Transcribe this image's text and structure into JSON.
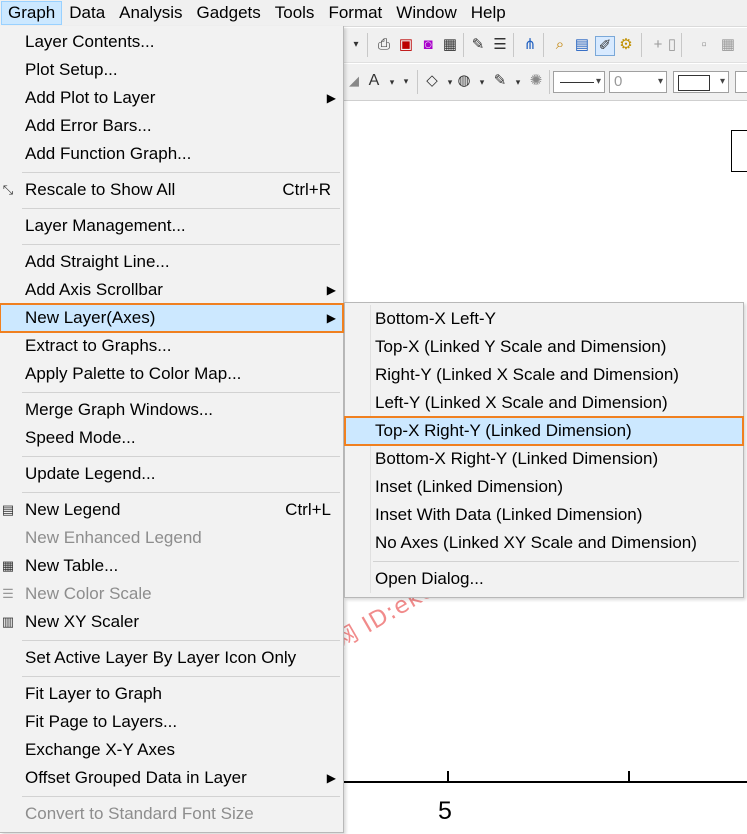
{
  "menubar": {
    "items": [
      "Graph",
      "Data",
      "Analysis",
      "Gadgets",
      "Tools",
      "Format",
      "Window",
      "Help"
    ]
  },
  "toolbar": {
    "width_value": "0"
  },
  "graph": {
    "x_tick_label": "5"
  },
  "watermark": "科袖网 ID:ekexiu-com",
  "menu": {
    "items": [
      {
        "label": "Layer Contents...",
        "shortcut": "",
        "submenu": false,
        "disabled": false,
        "icon": ""
      },
      {
        "label": "Plot Setup...",
        "shortcut": "",
        "submenu": false,
        "disabled": false,
        "icon": ""
      },
      {
        "label": "Add Plot to Layer",
        "shortcut": "",
        "submenu": true,
        "disabled": false,
        "icon": ""
      },
      {
        "label": "Add Error Bars...",
        "shortcut": "",
        "submenu": false,
        "disabled": false,
        "icon": ""
      },
      {
        "label": "Add Function Graph...",
        "shortcut": "",
        "submenu": false,
        "disabled": false,
        "icon": ""
      },
      {
        "label": "Rescale to Show All",
        "shortcut": "Ctrl+R",
        "submenu": false,
        "disabled": false,
        "icon": "rescale-icon"
      },
      {
        "label": "Layer Management...",
        "shortcut": "",
        "submenu": false,
        "disabled": false,
        "icon": ""
      },
      {
        "label": "Add Straight Line...",
        "shortcut": "",
        "submenu": false,
        "disabled": false,
        "icon": ""
      },
      {
        "label": "Add Axis Scrollbar",
        "shortcut": "",
        "submenu": true,
        "disabled": false,
        "icon": ""
      },
      {
        "label": "New Layer(Axes)",
        "shortcut": "",
        "submenu": true,
        "disabled": false,
        "icon": ""
      },
      {
        "label": "Extract to Graphs...",
        "shortcut": "",
        "submenu": false,
        "disabled": false,
        "icon": ""
      },
      {
        "label": "Apply Palette to Color Map...",
        "shortcut": "",
        "submenu": false,
        "disabled": false,
        "icon": ""
      },
      {
        "label": "Merge Graph Windows...",
        "shortcut": "",
        "submenu": false,
        "disabled": false,
        "icon": ""
      },
      {
        "label": "Speed Mode...",
        "shortcut": "",
        "submenu": false,
        "disabled": false,
        "icon": ""
      },
      {
        "label": "Update Legend...",
        "shortcut": "",
        "submenu": false,
        "disabled": false,
        "icon": ""
      },
      {
        "label": "New Legend",
        "shortcut": "Ctrl+L",
        "submenu": false,
        "disabled": false,
        "icon": "legend-icon"
      },
      {
        "label": "New Enhanced Legend",
        "shortcut": "",
        "submenu": false,
        "disabled": true,
        "icon": ""
      },
      {
        "label": "New Table...",
        "shortcut": "",
        "submenu": false,
        "disabled": false,
        "icon": "table-icon"
      },
      {
        "label": "New Color Scale",
        "shortcut": "",
        "submenu": false,
        "disabled": true,
        "icon": "color-scale-icon"
      },
      {
        "label": "New XY Scaler",
        "shortcut": "",
        "submenu": false,
        "disabled": false,
        "icon": "xy-scaler-icon"
      },
      {
        "label": "Set Active Layer By Layer Icon Only",
        "shortcut": "",
        "submenu": false,
        "disabled": false,
        "icon": ""
      },
      {
        "label": "Fit Layer to Graph",
        "shortcut": "",
        "submenu": false,
        "disabled": false,
        "icon": ""
      },
      {
        "label": "Fit Page to Layers...",
        "shortcut": "",
        "submenu": false,
        "disabled": false,
        "icon": ""
      },
      {
        "label": "Exchange X-Y Axes",
        "shortcut": "",
        "submenu": false,
        "disabled": false,
        "icon": ""
      },
      {
        "label": "Offset Grouped Data in Layer",
        "shortcut": "",
        "submenu": true,
        "disabled": false,
        "icon": ""
      },
      {
        "label": "Convert to Standard Font Size",
        "shortcut": "",
        "submenu": false,
        "disabled": true,
        "icon": ""
      }
    ]
  },
  "submenu": {
    "items": [
      "Bottom-X Left-Y",
      "Top-X (Linked Y Scale and Dimension)",
      "Right-Y (Linked X Scale and Dimension)",
      "Left-Y (Linked X Scale and Dimension)",
      "Top-X Right-Y (Linked Dimension)",
      "Bottom-X Right-Y (Linked Dimension)",
      "Inset (Linked Dimension)",
      "Inset With Data (Linked Dimension)",
      "No Axes (Linked XY Scale and Dimension)",
      "Open Dialog..."
    ]
  }
}
